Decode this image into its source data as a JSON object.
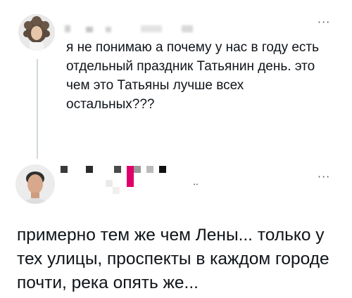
{
  "thread": {
    "reply_post": {
      "author_name": "",
      "avatar_icon": "curly-haired-person-avatar",
      "more_icon": "more-horizontal-icon",
      "more_label": "···",
      "text": "я не понимаю а почему у нас в году есть отдельный праздник Татьянин день. это чем это Татьяны лучше всех остальных???"
    },
    "main_post": {
      "author_name": "",
      "avatar_icon": "man-portrait-avatar",
      "more_icon": "more-horizontal-icon",
      "more_label": "···",
      "handle_fragment": "..",
      "text": "примерно тем же чем Лены... только у тех улицы, проспекты в каждом городе почти, река опять же..."
    }
  }
}
